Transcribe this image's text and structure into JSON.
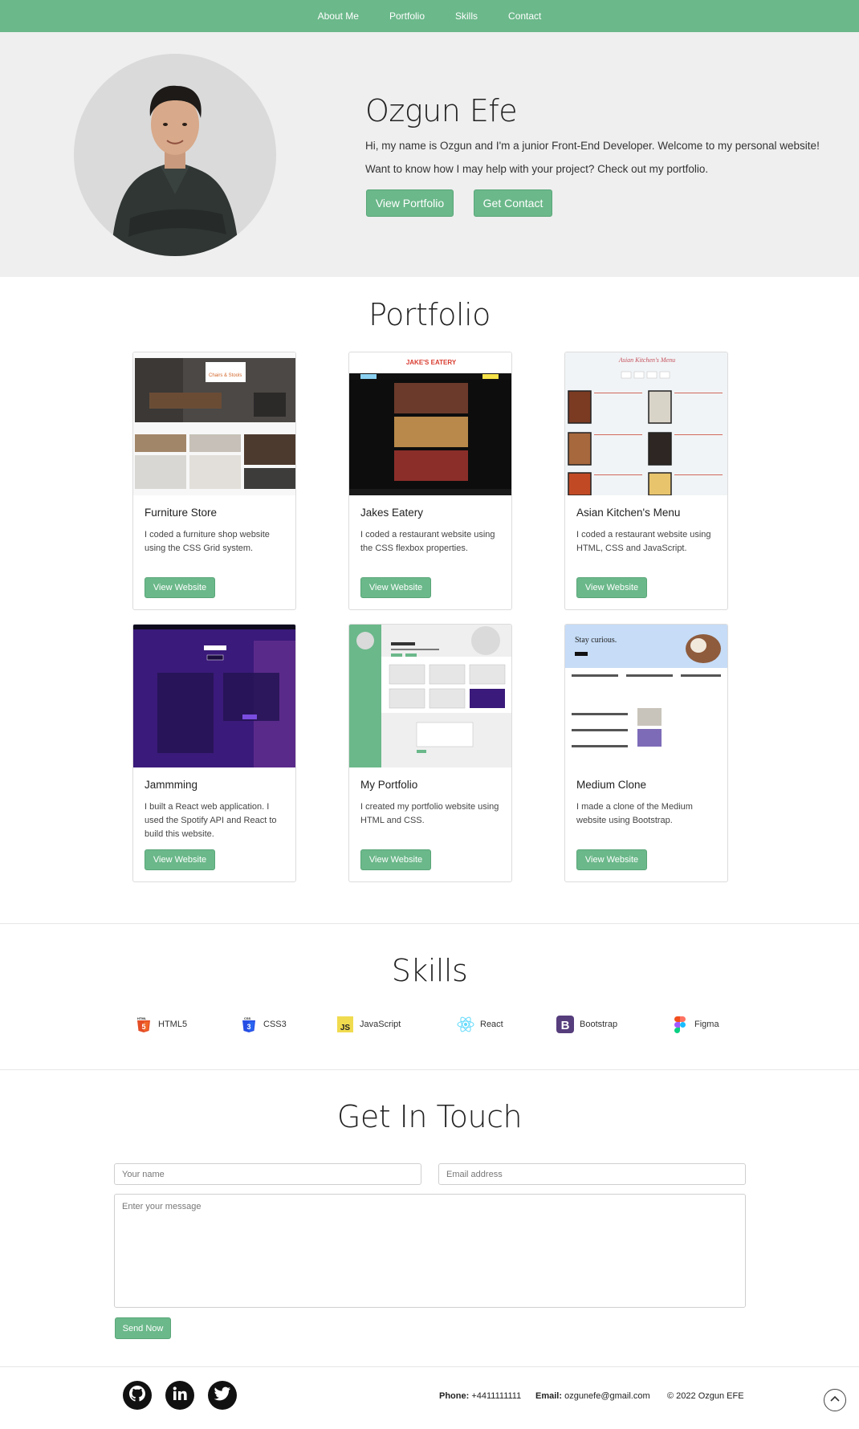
{
  "nav": {
    "items": [
      "About Me",
      "Portfolio",
      "Skills",
      "Contact"
    ]
  },
  "hero": {
    "name": "Ozgun Efe",
    "line1": "Hi, my name is Ozgun and I'm a junior Front-End Developer. Welcome to my personal website!",
    "line2": "Want to know how I may help with your project? Check out my portfolio.",
    "btn_portfolio": "View Portfolio",
    "btn_contact": "Get Contact"
  },
  "portfolio": {
    "title": "Portfolio",
    "button_label": "View Website",
    "cards": [
      {
        "title": "Furniture Store",
        "desc": "I coded a furniture shop website using the CSS Grid system.",
        "thumb_text": "Chairs & Stools"
      },
      {
        "title": "Jakes Eatery",
        "desc": "I coded a restaurant website using the CSS flexbox properties.",
        "thumb_text": "JAKE'S EATERY"
      },
      {
        "title": "Asian Kitchen's Menu",
        "desc": "I coded a restaurant website using HTML, CSS and JavaScript.",
        "thumb_text": "Asian Kitchen's Menu"
      },
      {
        "title": "Jammming",
        "desc": "I built a React web application. I used the Spotify API and React to build this website.",
        "thumb_text": "Jammming"
      },
      {
        "title": "My Portfolio",
        "desc": "I created my portfolio website using HTML and CSS.",
        "thumb_text": "Ozgun Efe"
      },
      {
        "title": "Medium Clone",
        "desc": "I made a clone of the Medium website using Bootstrap.",
        "thumb_text": "Stay curious."
      }
    ]
  },
  "skills": {
    "title": "Skills",
    "items": [
      {
        "label": "HTML5",
        "icon": "html5-icon",
        "color": "#e44d26"
      },
      {
        "label": "CSS3",
        "icon": "css3-icon",
        "color": "#264de4"
      },
      {
        "label": "JavaScript",
        "icon": "javascript-icon",
        "color": "#f0db4f"
      },
      {
        "label": "React",
        "icon": "react-icon",
        "color": "#61dafb"
      },
      {
        "label": "Bootstrap",
        "icon": "bootstrap-icon",
        "color": "#563d7c"
      },
      {
        "label": "Figma",
        "icon": "figma-icon",
        "color": "#f24e1e"
      }
    ]
  },
  "contact": {
    "title": "Get In Touch",
    "name_placeholder": "Your name",
    "email_placeholder": "Email address",
    "message_placeholder": "Enter your message",
    "send_label": "Send Now"
  },
  "footer": {
    "phone_label": "Phone:",
    "phone": "+4411111111",
    "email_label": "Email:",
    "email": "ozgunefe@gmail.com",
    "copyright": "© 2022 Ozgun EFE",
    "icons": [
      "github-icon",
      "linkedin-icon",
      "twitter-icon",
      "scroll-to-top-icon"
    ]
  },
  "colors": {
    "accent": "#6bb88a",
    "hero_bg": "#efefef"
  }
}
